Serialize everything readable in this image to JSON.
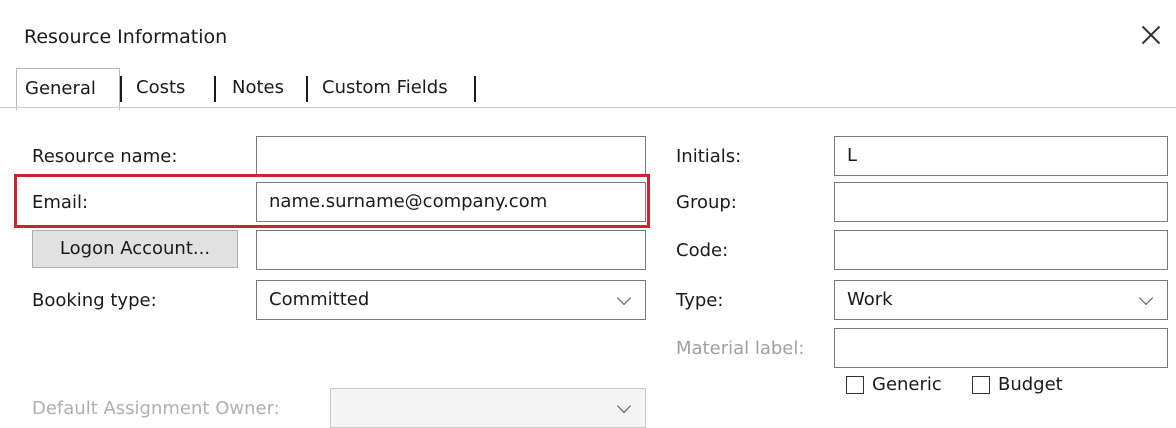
{
  "window": {
    "title": "Resource Information"
  },
  "tabs": [
    {
      "label": "General",
      "active": true
    },
    {
      "label": "Costs"
    },
    {
      "label": "Notes"
    },
    {
      "label": "Custom Fields"
    }
  ],
  "form": {
    "resource_name": {
      "label": "Resource name:",
      "value": ""
    },
    "email": {
      "label": "Email:",
      "value": "name.surname@company.com"
    },
    "logon_account": {
      "button_label": "Logon Account...",
      "value": ""
    },
    "booking_type": {
      "label": "Booking type:",
      "value": "Committed"
    },
    "default_owner": {
      "label": "Default Assignment Owner:",
      "value": ""
    },
    "initials": {
      "label": "Initials:",
      "value": "L"
    },
    "group": {
      "label": "Group:",
      "value": ""
    },
    "code": {
      "label": "Code:",
      "value": ""
    },
    "type": {
      "label": "Type:",
      "value": "Work"
    },
    "material_label": {
      "label": "Material label:",
      "value": ""
    },
    "generic": {
      "label": "Generic",
      "checked": false
    },
    "budget": {
      "label": "Budget",
      "checked": false
    }
  },
  "colors": {
    "highlight": "#c8262e"
  }
}
